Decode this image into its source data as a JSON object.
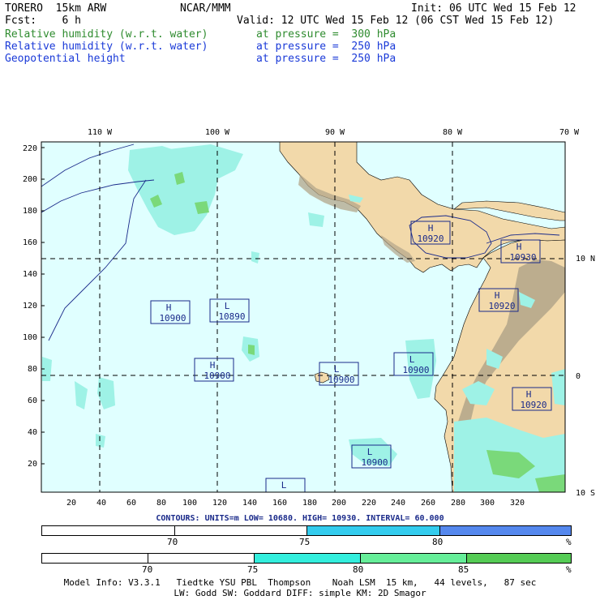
{
  "header": {
    "model": "TORERO  15km ARW",
    "org": "NCAR/MMM",
    "init": "Init: 06 UTC Wed 15 Feb 12",
    "fcst": "Fcst:    6 h",
    "valid": "Valid: 12 UTC Wed 15 Feb 12 (06 CST Wed 15 Feb 12)",
    "fields": [
      {
        "name": "Relative humidity (w.r.t. water)",
        "level": "at pressure =  300 hPa",
        "color": "#2e8b2e"
      },
      {
        "name": "Relative humidity (w.r.t. water)",
        "level": "at pressure =  250 hPa",
        "color": "#1a3ad8"
      },
      {
        "name": "Geopotential height",
        "level": "at pressure =  250 hPa",
        "color": "#1a3ad8"
      }
    ]
  },
  "map": {
    "top_lon_labels": [
      "110 W",
      "100 W",
      "90 W",
      "80 W",
      "70 W"
    ],
    "right_lat_labels": [
      "10 N",
      "0",
      "10 S"
    ],
    "left_ticks": [
      "220",
      "200",
      "180",
      "160",
      "140",
      "120",
      "100",
      "80",
      "60",
      "40",
      "20"
    ],
    "bottom_ticks": [
      "20",
      "40",
      "60",
      "80",
      "100",
      "120",
      "140",
      "160",
      "180",
      "200",
      "220",
      "240",
      "260",
      "280",
      "300",
      "320"
    ],
    "centers": [
      {
        "type": "H",
        "value": "10920"
      },
      {
        "type": "H",
        "value": "10930"
      },
      {
        "type": "H",
        "value": "10900"
      },
      {
        "type": "L",
        "value": "10890"
      },
      {
        "type": "H",
        "value": "10920"
      },
      {
        "type": "H",
        "value": "10900"
      },
      {
        "type": "L",
        "value": "10900"
      },
      {
        "type": "L",
        "value": "10900"
      },
      {
        "type": "H",
        "value": "10920"
      },
      {
        "type": "L",
        "value": "10900"
      },
      {
        "type": "L",
        "value": ""
      }
    ],
    "colors": {
      "ocean": "#e0ffff",
      "land": "#f2d9aa",
      "terrain": "#b3a58a",
      "rh_light": "#9ef2e6",
      "rh_green": "#7ad97a",
      "contour": "#1a2a8a"
    }
  },
  "contours_line": "CONTOURS: UNITS=m  LOW= 10680.   HIGH= 10930.   INTERVAL=  60.000",
  "colorbar1": {
    "labels": [
      "70",
      "75",
      "80"
    ],
    "unit": "%",
    "colors": [
      "#ffffff",
      "#ffffff",
      "#33ccee",
      "#5588ee"
    ]
  },
  "colorbar2": {
    "labels": [
      "70",
      "75",
      "80",
      "85"
    ],
    "unit": "%",
    "colors": [
      "#ffffff",
      "#ffffff",
      "#33eedd",
      "#66ee99",
      "#55cc55"
    ]
  },
  "footer": {
    "line1": "Model Info: V3.3.1   Tiedtke YSU PBL  Thompson    Noah LSM  15 km,   44 levels,   87 sec",
    "line2": "LW: Godd SW: Goddard DIFF: simple KM: 2D Smagor"
  }
}
